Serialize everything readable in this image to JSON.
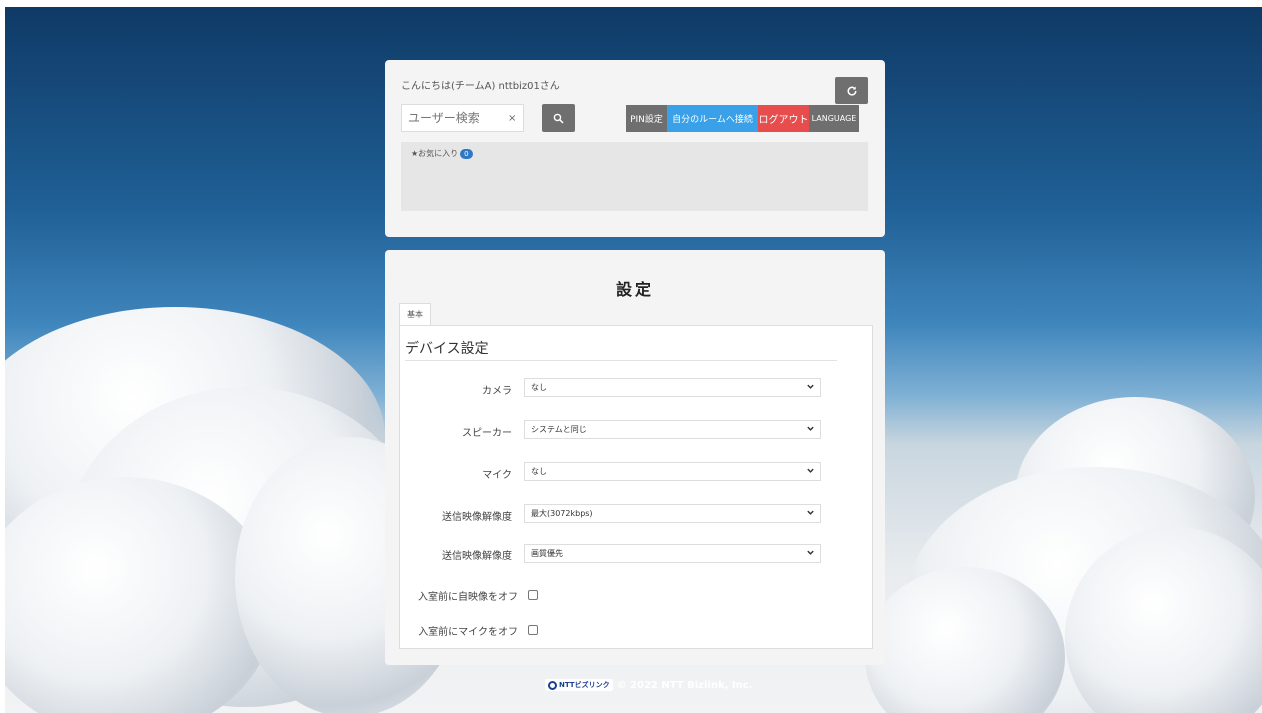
{
  "header": {
    "greeting": "こんにちは(チームA) nttbiz01さん"
  },
  "search": {
    "placeholder": "ユーザー検索",
    "clear_symbol": "×"
  },
  "actions": {
    "pin": "PIN設定",
    "room": "自分のルームへ接続",
    "logout": "ログアウト",
    "language": "LANGUAGE"
  },
  "favorites": {
    "label": "★お気に入り",
    "count": "0"
  },
  "settings": {
    "title": "設定",
    "tab": "基本",
    "section_title": "デバイス設定",
    "rows": [
      {
        "label": "カメラ",
        "value": "なし"
      },
      {
        "label": "スピーカー",
        "value": "システムと同じ"
      },
      {
        "label": "マイク",
        "value": "なし"
      },
      {
        "label": "送信映像解像度",
        "value": "最大(3072kbps)"
      },
      {
        "label": "送信映像解像度",
        "value": "画質優先"
      }
    ],
    "checks": [
      {
        "label": "入室前に自映像をオフ",
        "checked": false
      },
      {
        "label": "入室前にマイクをオフ",
        "checked": false
      }
    ]
  },
  "footer": {
    "logo_text": "NTTビズリンク",
    "copyright": "© 2022 NTT Bizlink, Inc."
  },
  "icons": {
    "refresh": "refresh-icon",
    "search": "search-icon",
    "chevron": "chevron-down-icon"
  }
}
